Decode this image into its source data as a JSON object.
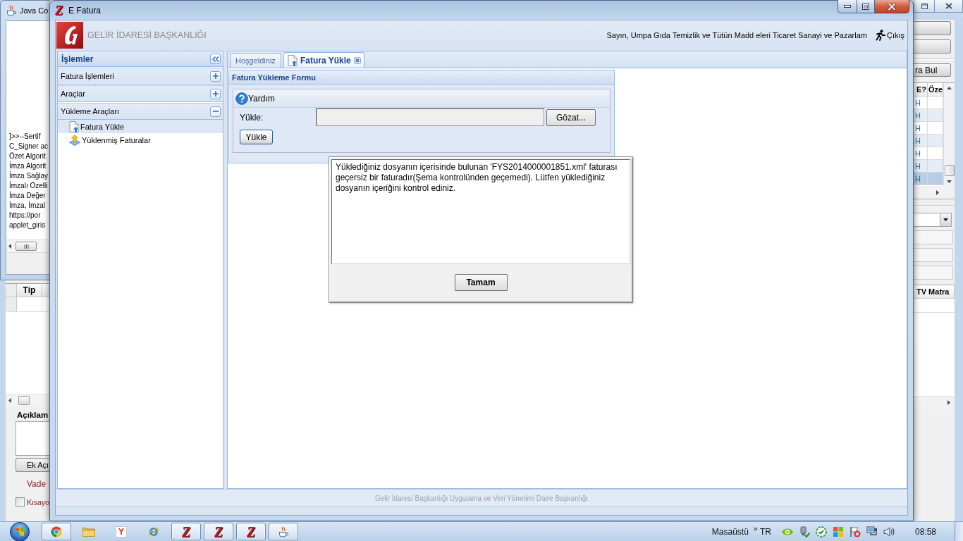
{
  "java_console": {
    "title": "Java Co",
    "lines": [
      "]>>--Sertif",
      "C_Signer ac",
      "Özet Algorit",
      "İmza Algorit",
      "İmza Sağlay",
      "İmzalı Özelli",
      "İmza Değer",
      "İmza, İmzal",
      "https://por",
      "applet_giris"
    ]
  },
  "background_app": {
    "left_table": {
      "columns": [
        "Tip"
      ]
    },
    "description_label": "Açıklam",
    "attachment_button": "Ek Açı",
    "due_label": "Vade",
    "shortcut_checkbox": {
      "label": "Kısayo",
      "checked": false
    },
    "find_button": "ra Bul",
    "top_table": {
      "columns": [
        "E?",
        "Öze"
      ],
      "rows": [
        {
          "column_1": "H",
          "selected": false
        },
        {
          "column_1": "H",
          "selected": false
        },
        {
          "column_1": "H",
          "selected": false
        },
        {
          "column_1": "H",
          "selected": false
        },
        {
          "column_1": "H",
          "selected": false
        },
        {
          "column_1": "H",
          "selected": false
        },
        {
          "column_1": "H",
          "selected": true
        }
      ]
    },
    "right_table": {
      "columns": [
        "TV Matra"
      ]
    }
  },
  "window": {
    "icon_letter": "Z",
    "title": "E Fatura"
  },
  "header": {
    "organization": "GELİR İDARESİ BAŞKANLIĞI",
    "greeting": "Sayın, Umpa Gıda Temizlik ve Tütün Madd eleri Ticaret Sanayi ve Pazarlam",
    "logout": "Çıkış"
  },
  "sidebar": {
    "title": "İşlemler",
    "groups": [
      {
        "label": "Fatura İşlemleri",
        "expanded": false
      },
      {
        "label": "Araçlar",
        "expanded": false
      },
      {
        "label": "Yükleme Araçları",
        "expanded": true,
        "children": [
          {
            "label": "Fatura Yükle",
            "kind": "file-upload",
            "selected": true
          },
          {
            "label": "Yüklenmiş Faturalar",
            "kind": "tray-upload",
            "selected": false
          }
        ]
      }
    ]
  },
  "tabs": [
    {
      "label": "Hoşgeldiniz",
      "kind": "plain",
      "selected": false,
      "closable": false
    },
    {
      "label": "Fatura Yükle",
      "kind": "file-upload",
      "selected": true,
      "closable": true
    }
  ],
  "form": {
    "title": "Fatura Yükleme Formu",
    "help": "Yardım",
    "file_label": "Yükle:",
    "browse_button": "Gözat...",
    "submit_button": "Yükle"
  },
  "dialog": {
    "message": "Yüklediğiniz dosyanın içerisinde bulunan 'FYS2014000001851.xml' faturası geçersiz bir faturadır(Şema kontrolünden geçemedi). Lütfen yüklediğiniz dosyanın içeriğini kontrol ediniz.",
    "button": "Tamam"
  },
  "footer": "Gelir İdaresi Başkanlığı Uygulama ve Veri Yönetimi Daire Başkanlığı",
  "taskbar": {
    "apps": [
      {
        "kind": "ring-logo",
        "running": true
      },
      {
        "kind": "folder",
        "running": false
      },
      {
        "kind": "letter-tile",
        "glyph": "Y",
        "running": false
      },
      {
        "kind": "globe",
        "running": false
      },
      {
        "kind": "letter",
        "glyph": "Z",
        "running": true
      },
      {
        "kind": "letter",
        "glyph": "Z",
        "running": true
      },
      {
        "kind": "letter",
        "glyph": "Z",
        "running": true
      },
      {
        "kind": "cup",
        "running": true
      }
    ],
    "desktop_toolbar": "Masaüstü",
    "toolbar_expander": "»",
    "language": "TR",
    "clock": "08:58"
  }
}
